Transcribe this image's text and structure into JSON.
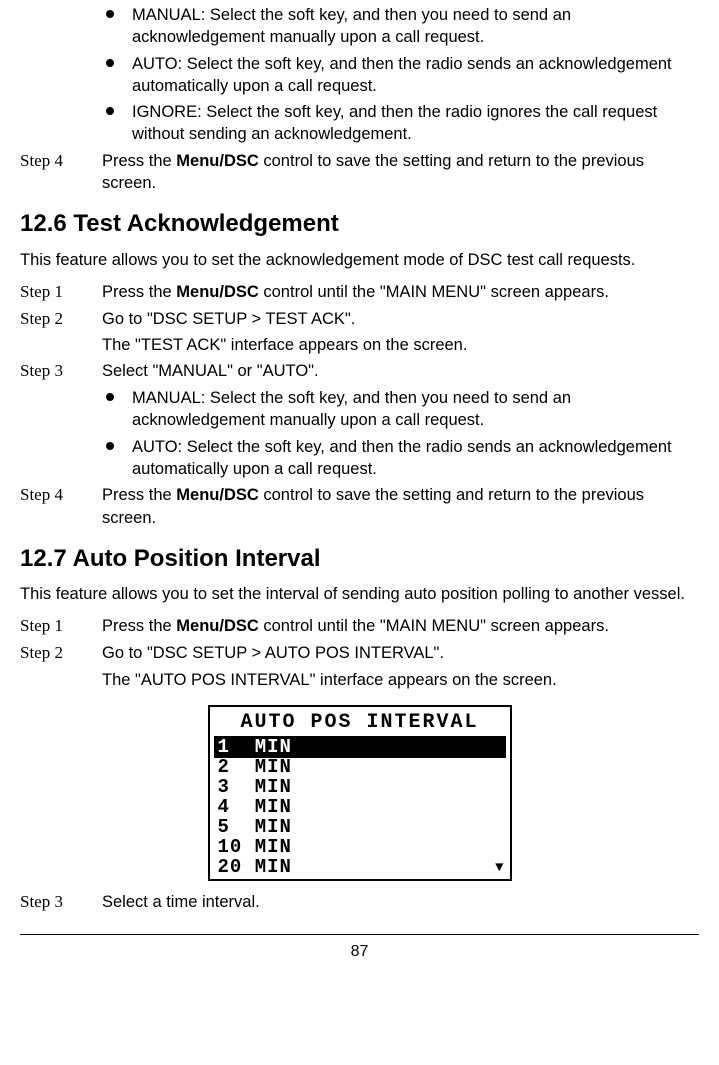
{
  "prev_section": {
    "bullets": [
      "MANUAL: Select the soft key, and then you need to send an acknowledgement manually upon a call request.",
      "AUTO: Select the soft key, and then the radio sends an acknowledgement automatically upon a call request.",
      "IGNORE: Select the soft key, and then the radio ignores the call request without sending an acknowledgement."
    ],
    "step4_label": "Step 4",
    "step4_pre": "Press the ",
    "step4_bold": "Menu/DSC",
    "step4_post": " control to save the setting and return to the previous screen."
  },
  "s126": {
    "heading": "12.6 Test Acknowledgement",
    "intro": "This feature allows you to set the acknowledgement mode of DSC test call requests.",
    "step1_label": "Step 1",
    "step1_pre": "Press the ",
    "step1_bold": "Menu/DSC",
    "step1_post": " control until the \"MAIN MENU\" screen appears.",
    "step2_label": "Step 2",
    "step2_line1": "Go to \"DSC SETUP > TEST ACK\".",
    "step2_line2": "The \"TEST ACK\" interface appears on the screen.",
    "step3_label": "Step 3",
    "step3_text": "Select \"MANUAL\" or \"AUTO\".",
    "bullets": [
      "MANUAL: Select the soft key, and then you need to send an acknowledgement manually upon a call request.",
      "AUTO: Select the soft key, and then the radio sends an acknowledgement automatically upon a call request."
    ],
    "step4_label": "Step 4",
    "step4_pre": "Press the ",
    "step4_bold": "Menu/DSC",
    "step4_post": " control to save the setting and return to the previous screen."
  },
  "s127": {
    "heading": "12.7 Auto Position Interval",
    "intro": "This feature allows you to set the interval of sending auto position polling to another vessel.",
    "step1_label": "Step 1",
    "step1_pre": "Press the ",
    "step1_bold": "Menu/DSC",
    "step1_post": " control until the \"MAIN MENU\" screen appears.",
    "step2_label": "Step 2",
    "step2_line1": "Go to \"DSC SETUP > AUTO POS INTERVAL\".",
    "step2_line2": "The \"AUTO POS INTERVAL\" interface appears on the screen.",
    "lcd_title": "AUTO POS INTERVAL",
    "lcd_items": [
      "1  MIN",
      "2  MIN",
      "3  MIN",
      "4  MIN",
      "5  MIN",
      "10 MIN",
      "20 MIN"
    ],
    "lcd_selected_index": 0,
    "step3_label": "Step 3",
    "step3_text": "Select a time interval."
  },
  "page_number": "87"
}
